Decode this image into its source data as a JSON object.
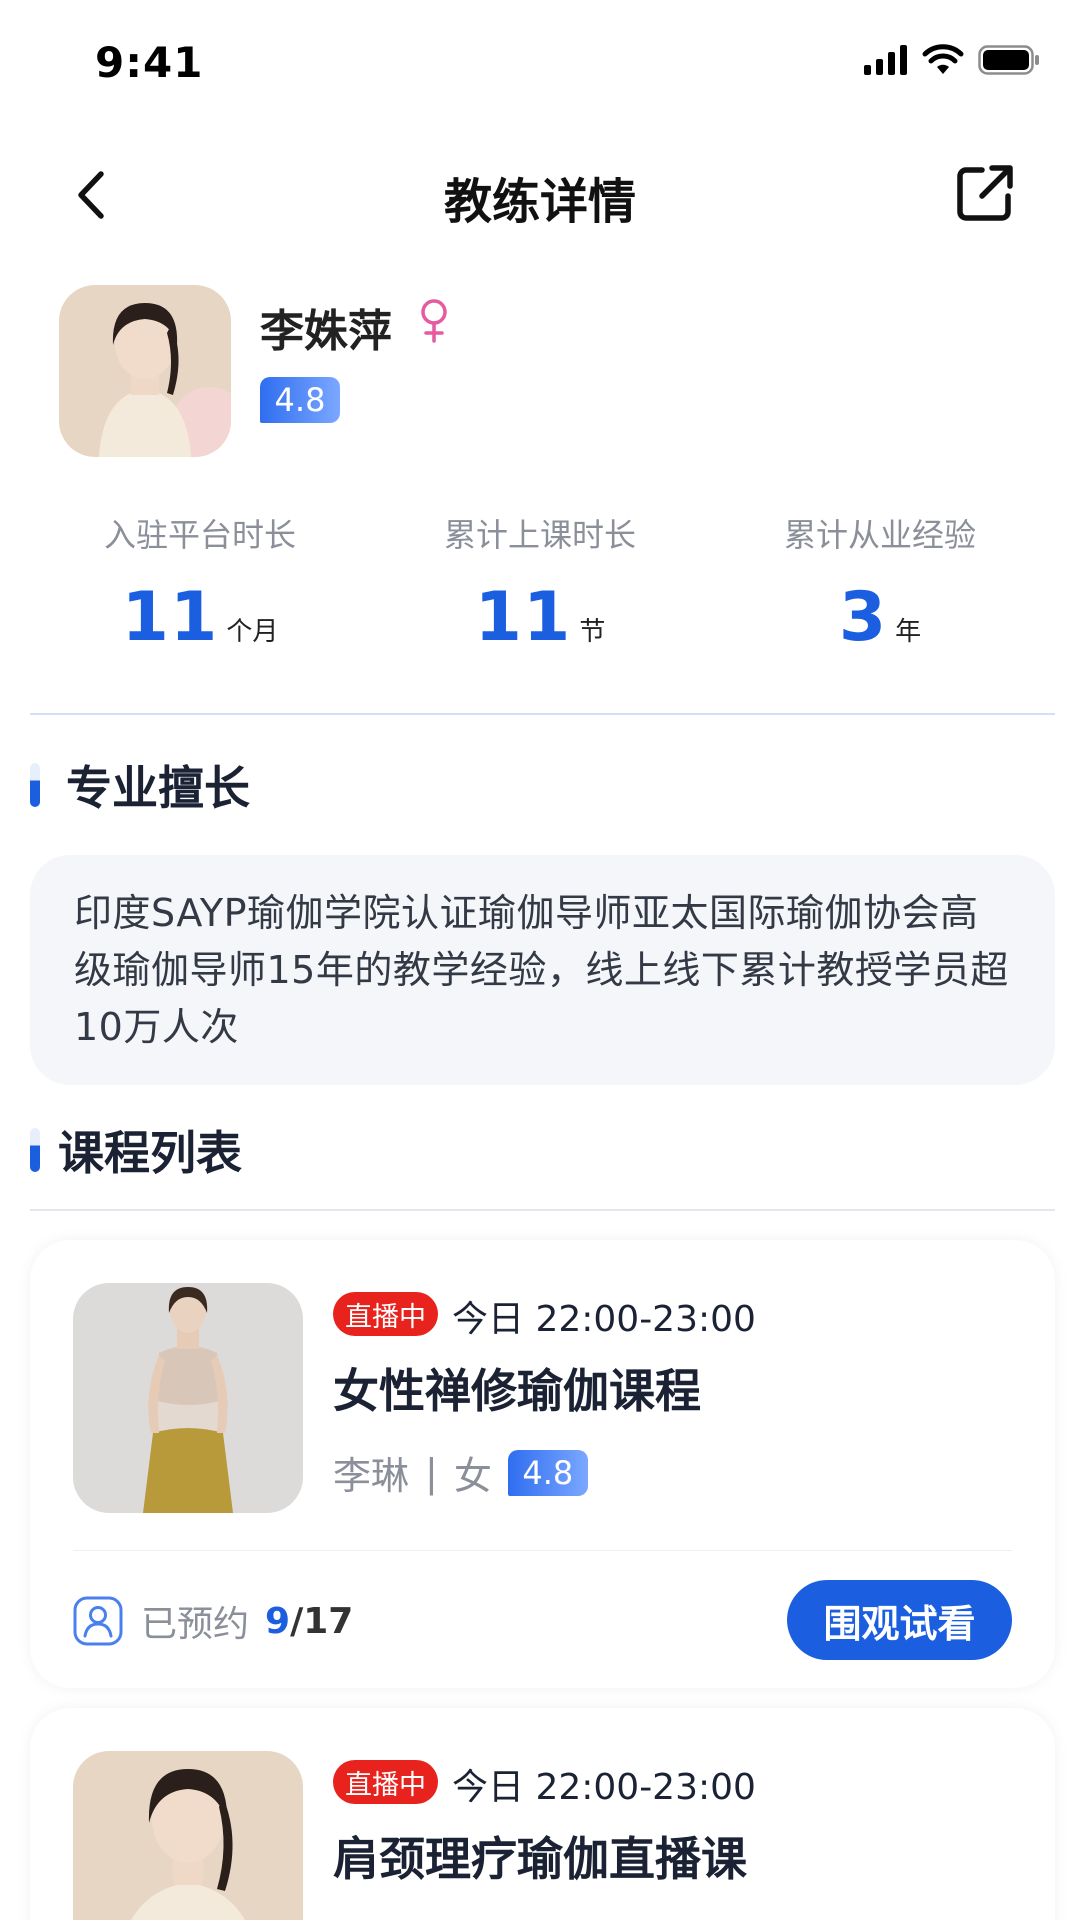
{
  "status_bar": {
    "time": "9:41"
  },
  "nav": {
    "title": "教练详情"
  },
  "coach": {
    "name": "李姝萍",
    "gender_symbol": "♀",
    "rating": "4.8"
  },
  "stats": [
    {
      "label": "入驻平台时长",
      "value": "11",
      "unit": "个月"
    },
    {
      "label": "累计上课时长",
      "value": "11",
      "unit": "节"
    },
    {
      "label": "累计从业经验",
      "value": "3",
      "unit": "年"
    }
  ],
  "specialty": {
    "title": "专业擅长",
    "text": "印度SAYP瑜伽学院认证瑜伽导师亚太国际瑜伽协会高级瑜伽导师15年的教学经验，线上线下累计教授学员超10万人次"
  },
  "course_section": {
    "title": "课程列表"
  },
  "courses": [
    {
      "live_tag": "直播中",
      "time": "今日 22:00-23:00",
      "title": "女性禅修瑜伽课程",
      "coach": "李琳",
      "separator": "|",
      "gender": "女",
      "rating": "4.8",
      "booked_label": "已预约",
      "booked_current": "9",
      "booked_total": "/17",
      "action_label": "围观试看"
    },
    {
      "live_tag": "直播中",
      "time": "今日 22:00-23:00",
      "title": "肩颈理疗瑜伽直播课"
    }
  ],
  "colors": {
    "primary": "#1b5fe0",
    "live": "#e8231e",
    "female": "#e55aa0"
  },
  "icons": {
    "back": "chevron-left-icon",
    "share": "share-icon",
    "booked": "user-icon",
    "gender": "female-icon"
  }
}
